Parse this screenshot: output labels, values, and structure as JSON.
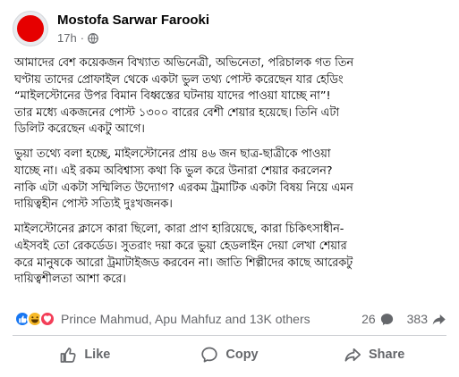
{
  "post": {
    "author": "Mostofa Sarwar Farooki",
    "time": "17h",
    "separator": "·",
    "visibility_icon": "globe-icon",
    "paragraphs": [
      [
        "আমাদের বেশ কয়েকজন বিখ্যাত অভিনেত্রী, অভিনেতা, পরিচালক গত তিন",
        "ঘণ্টায় তাদের প্রোফাইল থেকে একটা ভুল তথ্য পোস্ট করেছেন যার হেডিং",
        "“মাইলস্টোনের উপর বিমান বিধ্বস্তের ঘটনায় যাদের পাওয়া যাচ্ছে না”!",
        "তার মধ্যে একজনের পোস্ট ১৩০০ বারের বেশী শেয়ার হয়েছে। তিনি এটা",
        "ডিলিট করেছেন একটু আগে।"
      ],
      [
        "ভুয়া তথ্যে বলা হচ্ছে, মাইলস্টোনের প্রায় ৪৬ জন ছাত্র-ছাত্রীকে পাওয়া",
        "যাচ্ছে না। এই রকম অবিশ্বাস্য কথা কি ভুল করে উনারা শেয়ার করলেন?",
        "নাকি এটা একটা সম্মিলিত উদ্যোগ? এরকম ট্রমাটিক একটা বিষয় নিয়ে এমন",
        "দায়িত্বহীন পোস্ট সত্যিই দুঃখজনক।"
      ],
      [
        "মাইলস্টোনের ক্লাসে কারা ছিলো, কারা প্রাণ হারিয়েছে, কারা চিকিৎসাধীন-",
        "এইসবই তো রেকর্ডেড। সুতরাং দয়া করে ভুয়া হেডলাইন দেয়া লেখা শেয়ার",
        "করে মানুষকে আরো ট্রমাটাইজড করবেন না। জাতি শিল্পীদের কাছে আরেকটু",
        "দায়িত্বশীলতা আশা করে।"
      ]
    ]
  },
  "reactions": {
    "icons": [
      "like-icon",
      "haha-icon",
      "love-icon"
    ],
    "names": "Prince Mahmud, Apu Mahfuz and 13K others",
    "comments": "26",
    "shares": "383"
  },
  "actions": {
    "like": "Like",
    "copy": "Copy",
    "share": "Share"
  },
  "colors": {
    "like_blue": "#1877f2",
    "haha_yellow": "#f7b928",
    "love_red": "#f33e58",
    "secondary_text": "#65676b",
    "avatar_red": "#e60000"
  }
}
